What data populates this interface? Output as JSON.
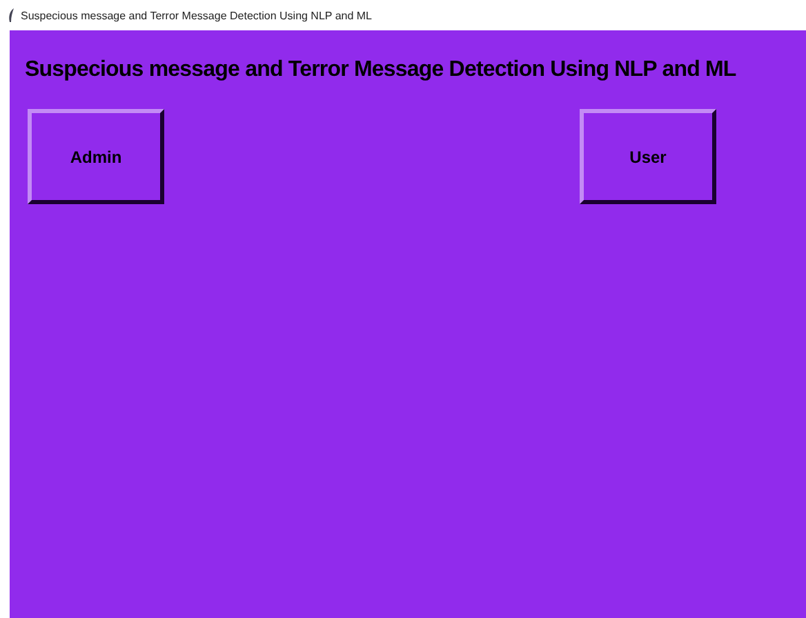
{
  "window": {
    "title": "Suspecious message and Terror Message Detection Using NLP and ML"
  },
  "heading": "Suspecious message and Terror Message Detection Using NLP and ML",
  "buttons": [
    {
      "label": "Admin"
    },
    {
      "label": "User"
    }
  ]
}
